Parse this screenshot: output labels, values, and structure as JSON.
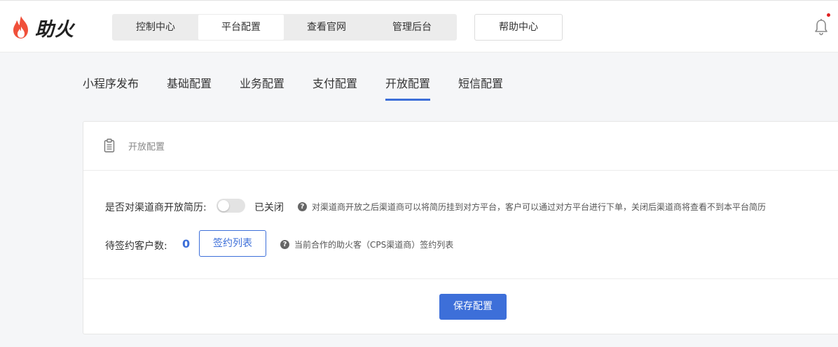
{
  "brand": {
    "name": "助火",
    "accent_color": "#3d6fd9",
    "flame_color": "#f0503a"
  },
  "header": {
    "nav": [
      {
        "label": "控制中心",
        "active": false
      },
      {
        "label": "平台配置",
        "active": true
      },
      {
        "label": "查看官网",
        "active": false
      },
      {
        "label": "管理后台",
        "active": false
      }
    ],
    "help_label": "帮助中心",
    "notification_icon": "bell-icon",
    "has_unread_notification": true
  },
  "tabs": [
    {
      "label": "小程序发布",
      "active": false
    },
    {
      "label": "基础配置",
      "active": false
    },
    {
      "label": "业务配置",
      "active": false
    },
    {
      "label": "支付配置",
      "active": false
    },
    {
      "label": "开放配置",
      "active": true
    },
    {
      "label": "短信配置",
      "active": false
    }
  ],
  "card": {
    "title": "开放配置",
    "title_icon": "clipboard-icon",
    "open_resume": {
      "label": "是否对渠道商开放简历:",
      "enabled": false,
      "status_text": "已关闭",
      "hint": "对渠道商开放之后渠道商可以将简历挂到对方平台，客户可以通过对方平台进行下单，关闭后渠道商将查看不到本平台简历"
    },
    "pending_clients": {
      "label": "待签约客户数:",
      "count": "0",
      "button_label": "签约列表",
      "hint": "当前合作的助火客（CPS渠道商）签约列表"
    },
    "save_label": "保存配置"
  }
}
